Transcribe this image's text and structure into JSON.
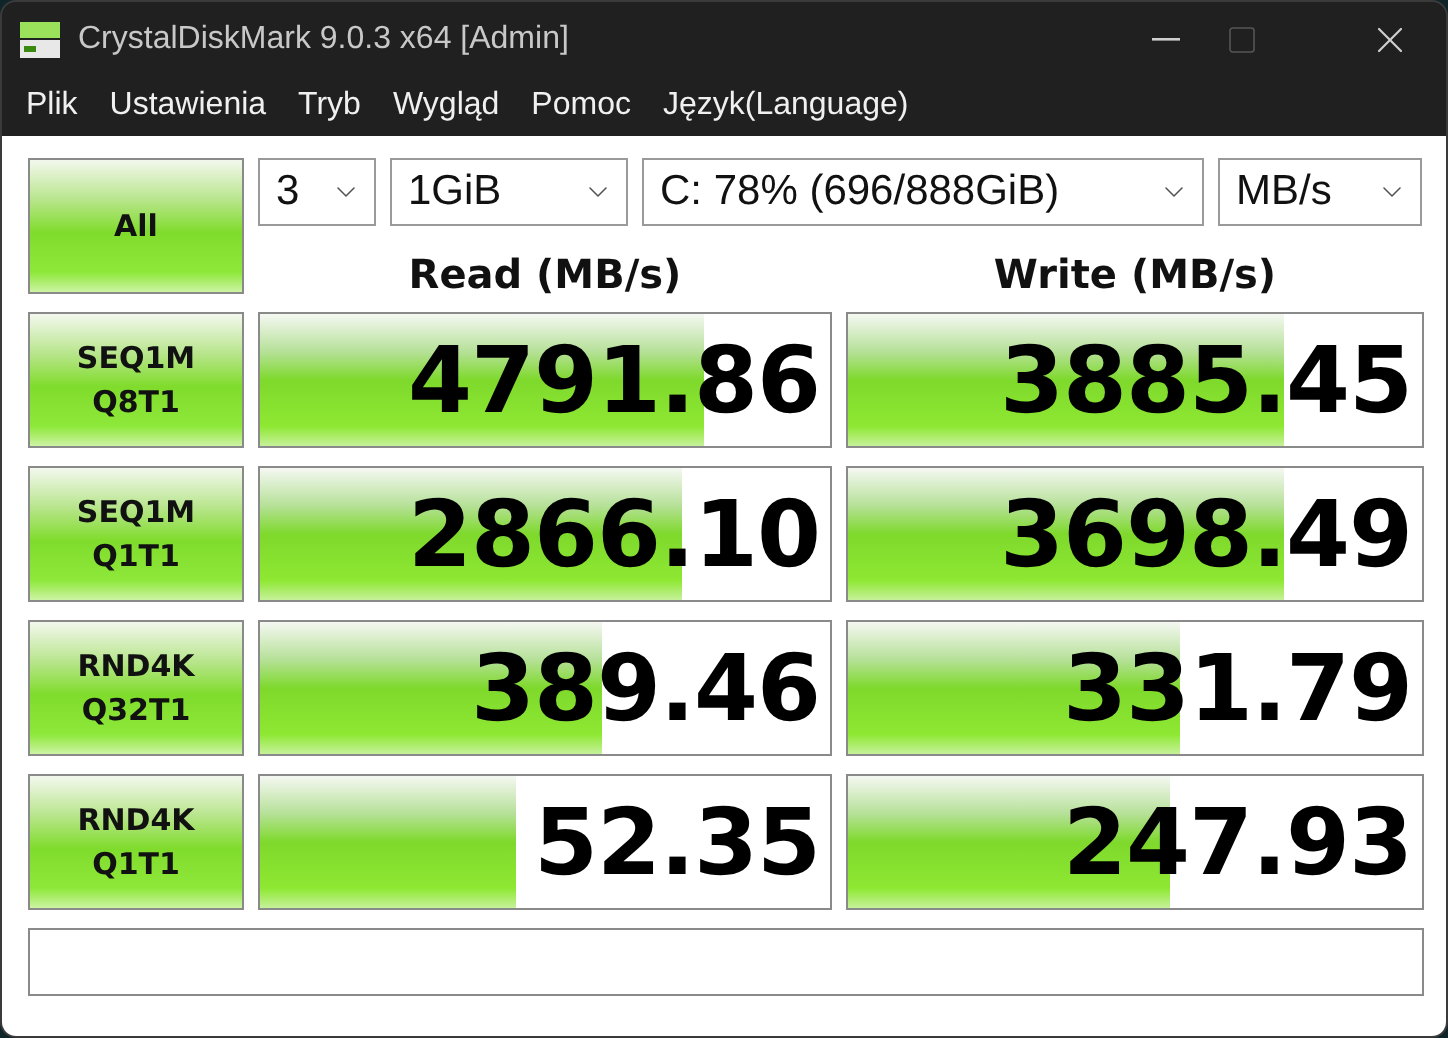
{
  "window": {
    "title": "CrystalDiskMark 9.0.3 x64 [Admin]"
  },
  "menu": [
    "Plik",
    "Ustawienia",
    "Tryb",
    "Wygląd",
    "Pomoc",
    "Język(Language)"
  ],
  "all_button": "All",
  "selects": [
    {
      "value": "3"
    },
    {
      "value": "1GiB"
    },
    {
      "value": "C: 78% (696/888GiB)"
    },
    {
      "value": "MB/s"
    }
  ],
  "headers": {
    "read": "Read (MB/s)",
    "write": "Write (MB/s)"
  },
  "tests": [
    {
      "label": [
        "SEQ1M",
        "Q8T1"
      ],
      "read": {
        "value": "4791.86",
        "level": 0.78
      },
      "write": {
        "value": "3885.45",
        "level": 0.76
      }
    },
    {
      "label": [
        "SEQ1M",
        "Q1T1"
      ],
      "read": {
        "value": "2866.10",
        "level": 0.74
      },
      "write": {
        "value": "3698.49",
        "level": 0.76
      }
    },
    {
      "label": [
        "RND4K",
        "Q32T1"
      ],
      "read": {
        "value": "389.46",
        "level": 0.6
      },
      "write": {
        "value": "331.79",
        "level": 0.58
      }
    },
    {
      "label": [
        "RND4K",
        "Q1T1"
      ],
      "read": {
        "value": "52.35",
        "level": 0.45
      },
      "write": {
        "value": "247.93",
        "level": 0.56
      }
    }
  ]
}
